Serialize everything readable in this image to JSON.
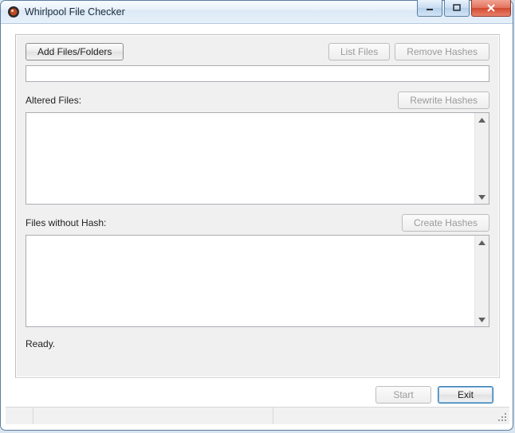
{
  "window": {
    "title": "Whirlpool File Checker"
  },
  "toolbar": {
    "add_files_folders": "Add Files/Folders",
    "list_files": "List Files",
    "remove_hashes": "Remove Hashes"
  },
  "path_input": {
    "value": "",
    "placeholder": ""
  },
  "sections": {
    "altered": {
      "label": "Altered Files:",
      "button": "Rewrite Hashes",
      "items": []
    },
    "no_hash": {
      "label": "Files without Hash:",
      "button": "Create Hashes",
      "items": []
    }
  },
  "status": {
    "message": "Ready."
  },
  "footer": {
    "start": "Start",
    "exit": "Exit"
  }
}
